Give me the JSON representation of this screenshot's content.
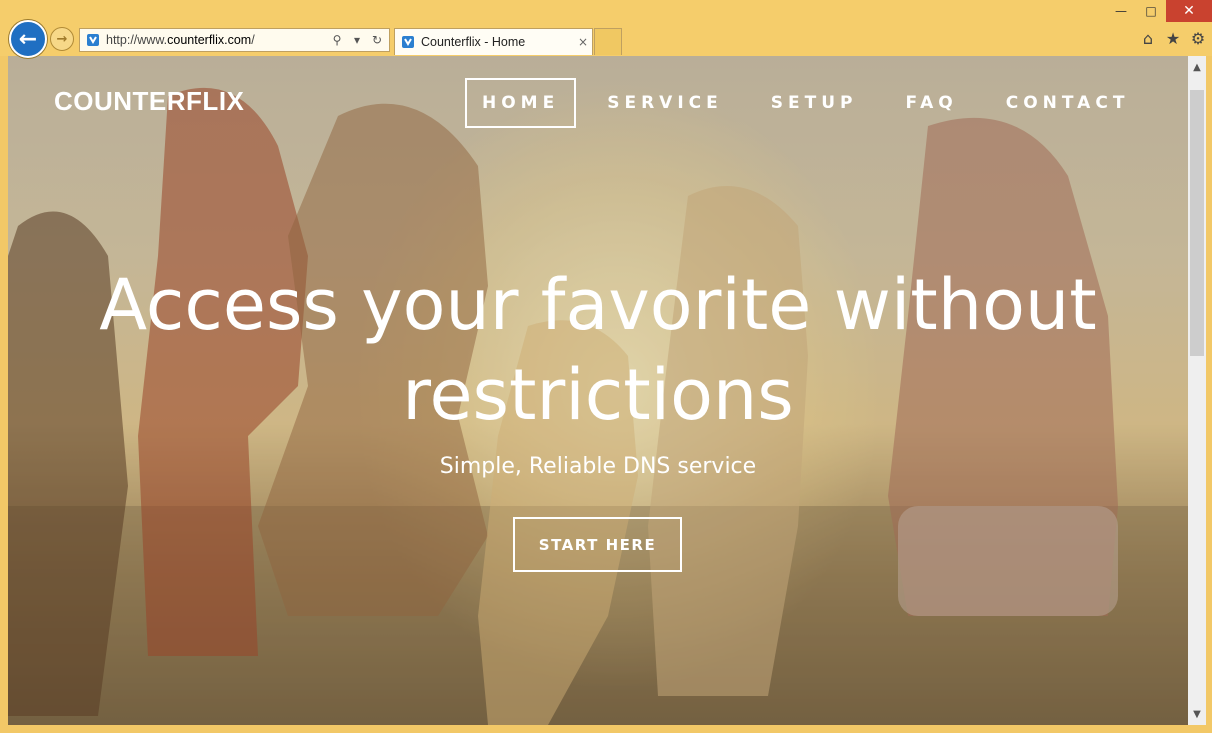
{
  "browser": {
    "url_prefix": "http://www.",
    "url_host": "counterflix.com",
    "url_suffix": "/",
    "tab_title": "Counterflix - Home",
    "tab_close": "×",
    "icons": [
      "back-arrow-icon",
      "forward-arrow-icon",
      "site-favicon",
      "search-icon",
      "refresh-icon",
      "home-icon",
      "star-icon",
      "gear-icon"
    ]
  },
  "site": {
    "brand": "COUNTERFLIX",
    "nav": [
      {
        "label": "HOME",
        "active": true
      },
      {
        "label": "SERVICE",
        "active": false
      },
      {
        "label": "SETUP",
        "active": false
      },
      {
        "label": "FAQ",
        "active": false
      },
      {
        "label": "CONTACT",
        "active": false
      }
    ],
    "hero": {
      "title_line1": "Access your favorite without",
      "title_line2": "restrictions",
      "subtitle": "Simple, Reliable DNS service",
      "cta": "START HERE"
    }
  }
}
